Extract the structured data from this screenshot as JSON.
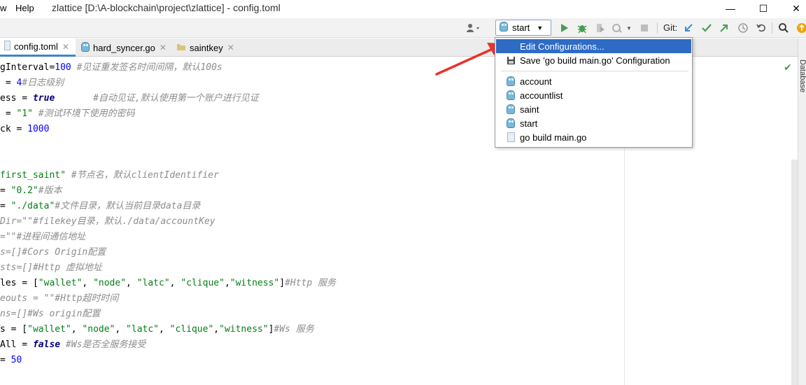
{
  "titlebar": {
    "menu": [
      "w",
      "Help"
    ],
    "title": "zlattice [D:\\A-blockchain\\project\\zlattice] - config.toml",
    "minimize": "—",
    "maximize": "☐",
    "close": "✕"
  },
  "toolbar": {
    "run_config": "start",
    "git_label": "Git:"
  },
  "tabs": [
    {
      "label": "config.toml",
      "active": true
    },
    {
      "label": "hard_syncer.go",
      "active": false
    },
    {
      "label": "saintkey",
      "active": false
    }
  ],
  "editor": {
    "lines": [
      [
        [
          "p",
          "gInterval="
        ],
        [
          "n",
          "100"
        ],
        [
          "c",
          " #见证重发签名时间间隔，默认100s"
        ]
      ],
      [
        [
          "p",
          " = "
        ],
        [
          "n",
          "4"
        ],
        [
          "c",
          "#日志级别"
        ]
      ],
      [
        [
          "p",
          "ess = "
        ],
        [
          "b",
          "true"
        ],
        [
          "c",
          "       #自动见证,默认使用第一个账户进行见证"
        ]
      ],
      [
        [
          "p",
          " = "
        ],
        [
          "s",
          "\"1\""
        ],
        [
          "c",
          " #测试环境下使用的密码"
        ]
      ],
      [
        [
          "p",
          "ck = "
        ],
        [
          "n",
          "1000"
        ]
      ],
      [],
      [],
      [
        [
          "s",
          "first_saint\""
        ],
        [
          "c",
          " #节点名，默认clientIdentifier"
        ]
      ],
      [
        [
          "p",
          "= "
        ],
        [
          "s",
          "\"0.2\""
        ],
        [
          "c",
          "#版本"
        ]
      ],
      [
        [
          "p",
          "= "
        ],
        [
          "s",
          "\"./data\""
        ],
        [
          "c",
          "#文件目录，默认当前目录data目录"
        ]
      ],
      [
        [
          "c",
          "Dir=\"\"#filekey目录，默认./data/accountKey"
        ]
      ],
      [
        [
          "c",
          "=\"\"#进程间通信地址"
        ]
      ],
      [
        [
          "c",
          "s=[]#Cors Origin配置"
        ]
      ],
      [
        [
          "c",
          "sts=[]#Http 虚拟地址"
        ]
      ],
      [
        [
          "p",
          "les = ["
        ],
        [
          "s",
          "\"wallet\""
        ],
        [
          "p",
          ", "
        ],
        [
          "s",
          "\"node\""
        ],
        [
          "p",
          ", "
        ],
        [
          "s",
          "\"latc\""
        ],
        [
          "p",
          ", "
        ],
        [
          "s",
          "\"clique\""
        ],
        [
          "p",
          ","
        ],
        [
          "s",
          "\"witness\""
        ],
        [
          "p",
          "]"
        ],
        [
          "c",
          "#Http 服务"
        ]
      ],
      [
        [
          "c",
          "eouts = \"\"#Http超时时间"
        ]
      ],
      [
        [
          "c",
          "ns=[]#Ws origin配置"
        ]
      ],
      [
        [
          "p",
          "s = ["
        ],
        [
          "s",
          "\"wallet\""
        ],
        [
          "p",
          ", "
        ],
        [
          "s",
          "\"node\""
        ],
        [
          "p",
          ", "
        ],
        [
          "s",
          "\"latc\""
        ],
        [
          "p",
          ", "
        ],
        [
          "s",
          "\"clique\""
        ],
        [
          "p",
          ","
        ],
        [
          "s",
          "\"witness\""
        ],
        [
          "p",
          "]"
        ],
        [
          "c",
          "#Ws 服务"
        ]
      ],
      [
        [
          "p",
          "All = "
        ],
        [
          "b",
          "false"
        ],
        [
          "c",
          " #Ws是否全服务接受"
        ]
      ],
      [
        [
          "p",
          "= "
        ],
        [
          "n",
          "50"
        ]
      ]
    ]
  },
  "sidebar_right": {
    "label": "Database"
  },
  "dropdown": {
    "items": [
      {
        "label": "Edit Configurations...",
        "selected": true,
        "icon": "none"
      },
      {
        "label": "Save 'go build main.go' Configuration",
        "selected": false,
        "icon": "save-icon"
      },
      {
        "label": "account",
        "selected": false,
        "icon": "gopher-icon"
      },
      {
        "label": "accountlist",
        "selected": false,
        "icon": "gopher-icon"
      },
      {
        "label": "saint",
        "selected": false,
        "icon": "gopher-icon"
      },
      {
        "label": "start",
        "selected": false,
        "icon": "gopher-icon"
      },
      {
        "label": "go build main.go",
        "selected": false,
        "icon": "file-icon"
      }
    ]
  },
  "colors": {
    "accent": "#2e6bc5",
    "arrow": "#e8322a",
    "run_green": "#499c54"
  }
}
